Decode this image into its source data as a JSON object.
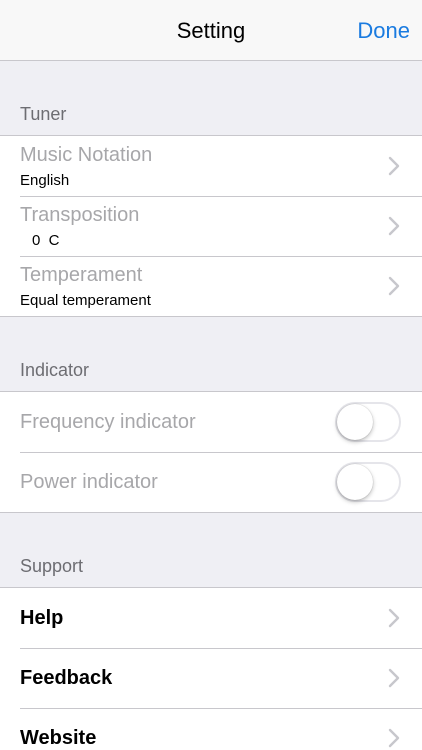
{
  "navbar": {
    "title": "Setting",
    "done_label": "Done"
  },
  "sections": {
    "tuner": {
      "header": "Tuner",
      "music_notation": {
        "title": "Music Notation",
        "value": "English",
        "icon": "chevron-right-icon"
      },
      "transposition": {
        "title": "Transposition",
        "value": "0  C",
        "icon": "chevron-right-icon"
      },
      "temperament": {
        "title": "Temperament",
        "value": "Equal temperament",
        "icon": "chevron-right-icon"
      }
    },
    "indicator": {
      "header": "Indicator",
      "frequency": {
        "title": "Frequency indicator",
        "on": false
      },
      "power": {
        "title": "Power indicator",
        "on": false
      }
    },
    "support": {
      "header": "Support",
      "help": {
        "title": "Help",
        "icon": "chevron-right-icon"
      },
      "feedback": {
        "title": "Feedback",
        "icon": "chevron-right-icon"
      },
      "website": {
        "title": "Website",
        "icon": "chevron-right-icon"
      }
    }
  },
  "colors": {
    "accent": "#1a7be0",
    "background": "#efeff4",
    "disabled_text": "#a7a7aa",
    "section_header_text": "#6d6d72",
    "chevron": "#c7c7cc"
  }
}
